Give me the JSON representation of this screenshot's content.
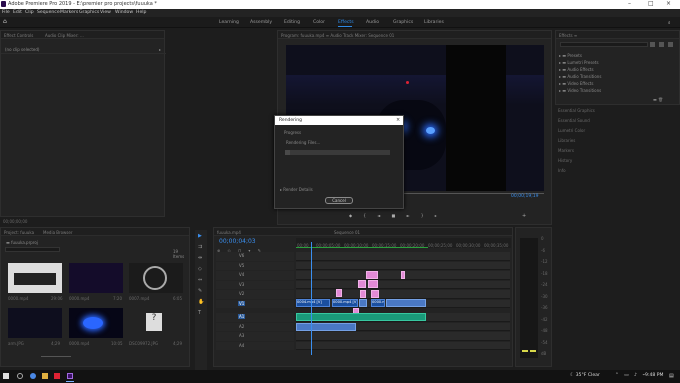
{
  "window": {
    "title": "Adobe Premiere Pro 2019 - E:\\premier pro projects\\fuuuka *"
  },
  "menu": [
    "File",
    "Edit",
    "Clip",
    "Sequence",
    "Markers",
    "Graphics",
    "View",
    "Window",
    "Help"
  ],
  "workspaces": [
    "Learning",
    "Assembly",
    "Editing",
    "Color",
    "Effects",
    "Audio",
    "Graphics",
    "Libraries"
  ],
  "active_workspace": "Effects",
  "effect_controls": {
    "tab": "Effect Controls",
    "tab2": "Audio Clip Mixer: ...",
    "no_clip": "(no clip selected)"
  },
  "program": {
    "tab": "Program: fuuuka.mp4 ≡   Audio Track Mixer: Sequence 01",
    "timecode": "00;00;19;19"
  },
  "effects_panel": {
    "items": [
      "Presets",
      "Lumetri Presets",
      "Audio Effects",
      "Audio Transitions",
      "Video Effects",
      "Video Transitions"
    ],
    "collapsed": [
      "Essential Graphics",
      "Essential Sound",
      "Lumetri Color",
      "Libraries",
      "Markers",
      "History",
      "Info"
    ]
  },
  "rendering": {
    "title": "Rendering",
    "progress_label": "Progress",
    "status": "Rendering Files...",
    "details": "Render Details",
    "cancel": "Cancel",
    "progress": 0.05
  },
  "project": {
    "tab": "Project: fuuuka",
    "tab2": "Media Browser",
    "file": "fuuuka.prproj",
    "count": "19 Items",
    "items": [
      {
        "name": "0000.mp4",
        "dur": "29:06"
      },
      {
        "name": "0000.mp4",
        "dur": "7:20"
      },
      {
        "name": "0007.mp4",
        "dur": "6:05"
      },
      {
        "name": "arm.JPG",
        "dur": "4;29"
      },
      {
        "name": "0000.mp4",
        "dur": "10:05"
      },
      {
        "name": "DSC09972.JPG",
        "dur": "4;29"
      }
    ]
  },
  "timeline": {
    "tab": "fuuuka.mp4",
    "tab2": "Sequence 01",
    "timecode": "00;00;04;03",
    "ruler": [
      "00;00",
      "00;00;05;00",
      "00;00;10;00",
      "00;00;15;00",
      "00;00;20;00",
      "00;00;25;00",
      "00;00;30;00",
      "00;00;35;00",
      "00;00;40;00",
      "00;00;45;00"
    ],
    "tracks": [
      "V6",
      "V5",
      "V4",
      "V3",
      "V2",
      "V1",
      "A1",
      "A2",
      "A3",
      "A4"
    ],
    "clip_labels": [
      "0004.mp4 [V]",
      "0000.mp4 [V]",
      "0000.mp4"
    ]
  },
  "meter": {
    "labels": [
      "0",
      "-6",
      "-12",
      "-18",
      "-24",
      "-30",
      "-36",
      "-42",
      "-48",
      "-54",
      "dB"
    ]
  },
  "taskbar": {
    "weather": "35°F Clear",
    "time": "9:48 PM"
  }
}
